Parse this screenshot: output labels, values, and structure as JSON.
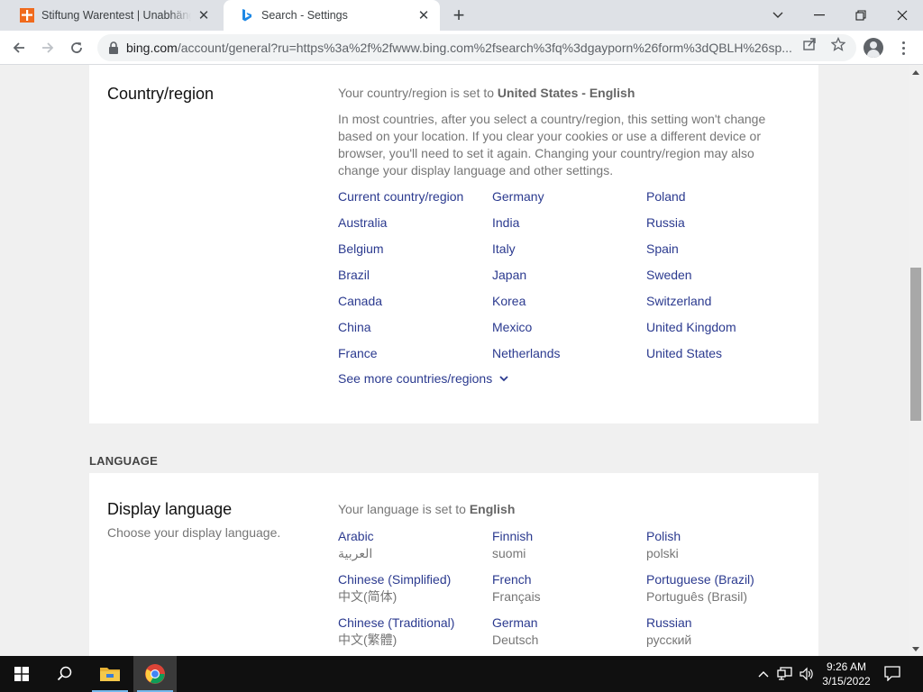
{
  "browser": {
    "tabs": [
      {
        "title": "Stiftung Warentest | Unabhängige",
        "active": false,
        "favicon": "stiftung-warentest-icon"
      },
      {
        "title": "Search - Settings",
        "active": true,
        "favicon": "bing-icon"
      }
    ],
    "url_host": "bing.com",
    "url_rest": "/account/general?ru=https%3a%2f%2fwww.bing.com%2fsearch%3fq%3dgayporn%26form%3dQBLH%26sp..."
  },
  "country_section": {
    "title": "Country/region",
    "set_to_prefix": "Your country/region is set to ",
    "set_to_value": "United States - English",
    "description": "In most countries, after you select a country/region, this setting won't change based on your location. If you clear your cookies or use a different device or browser, you'll need to set it again. Changing your country/region may also change your display language and other settings.",
    "links": [
      "Current country/region",
      "Germany",
      "Poland",
      "Australia",
      "India",
      "Russia",
      "Belgium",
      "Italy",
      "Spain",
      "Brazil",
      "Japan",
      "Sweden",
      "Canada",
      "Korea",
      "Switzerland",
      "China",
      "Mexico",
      "United Kingdom",
      "France",
      "Netherlands",
      "United States"
    ],
    "see_more": "See more countries/regions"
  },
  "language_heading": "LANGUAGE",
  "language_section": {
    "title": "Display language",
    "subtitle": "Choose your display language.",
    "set_to_prefix": "Your language is set to ",
    "set_to_value": "English",
    "languages": [
      {
        "name": "Arabic",
        "native": "العربية"
      },
      {
        "name": "Finnish",
        "native": "suomi"
      },
      {
        "name": "Polish",
        "native": "polski"
      },
      {
        "name": "Chinese (Simplified)",
        "native": "中文(简体)"
      },
      {
        "name": "French",
        "native": "Français"
      },
      {
        "name": "Portuguese (Brazil)",
        "native": "Português (Brasil)"
      },
      {
        "name": "Chinese (Traditional)",
        "native": "中文(繁體)"
      },
      {
        "name": "German",
        "native": "Deutsch"
      },
      {
        "name": "Russian",
        "native": "русский"
      }
    ]
  },
  "taskbar": {
    "time": "9:26 AM",
    "date": "3/15/2022"
  }
}
